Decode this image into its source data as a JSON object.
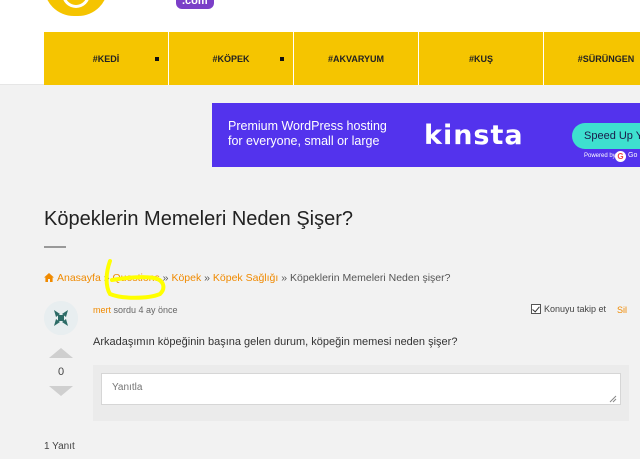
{
  "header": {
    "logo_com": ".com",
    "nav": [
      {
        "label": "#KEDİ"
      },
      {
        "label": "#KÖPEK"
      },
      {
        "label": "#AKVARYUM"
      },
      {
        "label": "#KUŞ"
      },
      {
        "label": "#SÜRÜNGEN"
      }
    ]
  },
  "ad": {
    "line1": "Premium WordPress hosting",
    "line2": "for everyone, small or large",
    "brand": "kinsta",
    "cta": "Speed Up Y",
    "powered": "Powered by",
    "powered_brand": "Go"
  },
  "page": {
    "title": "Köpeklerin Memeleri Neden Şişer?"
  },
  "breadcrumb": {
    "home": "Anasayfa",
    "sep": "»",
    "item1": "Questions",
    "item2": "Köpek",
    "item3": "Köpek Sağlığı",
    "current": "Köpeklerin Memeleri Neden şişer?"
  },
  "question": {
    "author": "mert",
    "asked": "sordu 4 ay önce",
    "follow_label": "Konuyu takip et",
    "delete_label": "Sil",
    "votes": "0",
    "body": "Arkadaşımın köpeğinin başına gelen durum, köpeğin memesi neden şişer?"
  },
  "reply": {
    "placeholder": "Yanıtla"
  },
  "answers": {
    "count_label": "1 Yanıt"
  },
  "colors": {
    "nav_bg": "#f5c500",
    "accent_link": "#f08a00",
    "ad_bg": "#5333ed",
    "ad_cta": "#3ee0cf",
    "highlight": "#ffff00"
  }
}
